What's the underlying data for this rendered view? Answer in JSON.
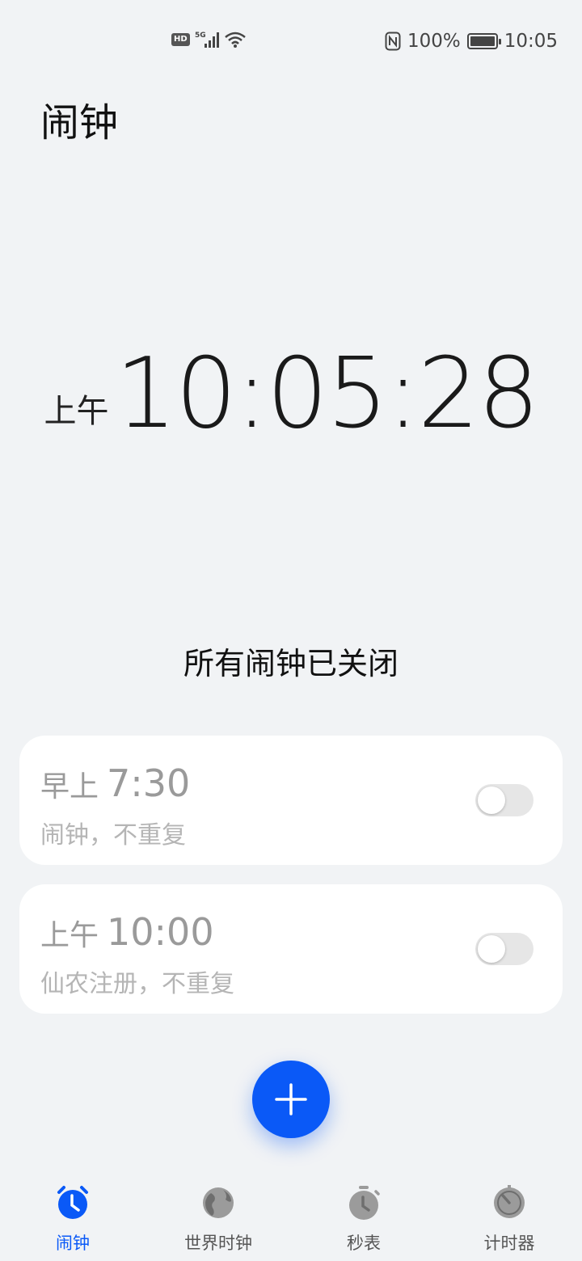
{
  "status_bar": {
    "hd": "HD",
    "network": "5G",
    "battery_pct": "100%",
    "battery_level": 1.0,
    "time": "10:05"
  },
  "title": "闹钟",
  "clock": {
    "ampm": "上午",
    "time": "10:05:28"
  },
  "all_off_text": "所有闹钟已关闭",
  "alarms": [
    {
      "period": "早上",
      "time": "7:30",
      "desc": "闹钟，不重复",
      "enabled": false
    },
    {
      "period": "上午",
      "time": "10:00",
      "desc": "仙农注册，不重复",
      "enabled": false
    }
  ],
  "colors": {
    "accent": "#0a59f7",
    "background": "#f1f3f5"
  },
  "nav": [
    {
      "label": "闹钟",
      "icon": "alarm-clock-icon",
      "active": true
    },
    {
      "label": "世界时钟",
      "icon": "globe-icon",
      "active": false
    },
    {
      "label": "秒表",
      "icon": "stopwatch-icon",
      "active": false
    },
    {
      "label": "计时器",
      "icon": "timer-icon",
      "active": false
    }
  ]
}
